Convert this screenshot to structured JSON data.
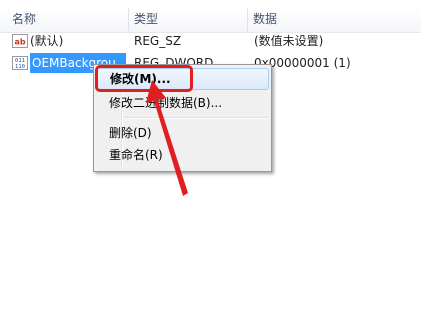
{
  "columns": {
    "name": "名称",
    "type": "类型",
    "data": "数据"
  },
  "rows": [
    {
      "icon": "string-value-icon",
      "icon_text": "ab",
      "name": "(默认)",
      "type": "REG_SZ",
      "data": "(数值未设置)"
    },
    {
      "icon": "dword-value-icon",
      "icon_text": "011",
      "name": "OEMBackgrou",
      "type": "REG_DWORD",
      "data": "0x00000001 (1)"
    }
  ],
  "context_menu": {
    "items": [
      "修改(M)...",
      "修改二进制数据(B)...",
      "删除(D)",
      "重命名(R)"
    ]
  },
  "colors": {
    "annotation": "#e02020",
    "selection": "#3399ff"
  }
}
